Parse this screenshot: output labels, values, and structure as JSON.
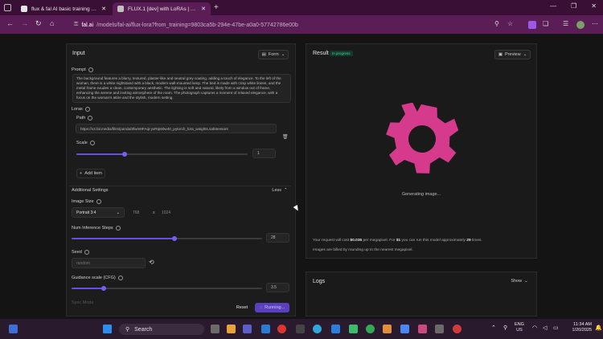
{
  "browser": {
    "tabs": [
      {
        "title": "flux & fal AI basic training Lo...",
        "active": false
      },
      {
        "title": "FLUX.1 [dev] with LoRAs | Text t...",
        "active": true
      }
    ],
    "url_host": "fal.ai",
    "url_path": "/models/fal-ai/flux-lora?from_training=9803ca5b-294e-47be-a0a0-57742786e00b"
  },
  "input_panel": {
    "title": "Input",
    "form_button": "Form",
    "prompt_label": "Prompt",
    "prompt_text": "The background features a blurry, textured, plaster-like and neutral grey coating, adding a touch of elegance. To the left of the woman, there is a white nightstand with a black, modern wall-mounted lamp. The bed is made with crisp white linens, and the metal frame exudes a clean, contemporary aesthetic. The lighting is soft and natural, likely from a window out of frame, enhancing the serene and inviting atmosphere of the room. The photograph captures a moment of relaxed elegance, with a focus on the woman's attire and the stylish, modern setting.",
    "loras_label": "Loras",
    "path_label": "Path",
    "path_value": "https://v3.fal.media/files/panda/8fwm8FAqi-yxRtp60w40_pytorch_lora_weights.safetensors",
    "scale_label": "Scale",
    "scale_value": "1",
    "scale_fraction": 0.28,
    "add_item": "Add item",
    "additional_settings": "Additional Settings",
    "less_button": "Less",
    "image_size_label": "Image Size",
    "image_size_value": "Portrait 3:4",
    "width_value": "768",
    "x_sep": "x",
    "height_value": "1024",
    "steps_label": "Num Inference Steps",
    "steps_value": "28",
    "steps_fraction": 0.54,
    "seed_label": "Seed",
    "seed_placeholder": "random",
    "guidance_label": "Guidance scale (CFG)",
    "guidance_value": "3.5",
    "guidance_fraction": 0.17,
    "sync_mode_label": "Sync Mode",
    "reset_button": "Reset",
    "run_button": "Running..."
  },
  "result_panel": {
    "title": "Result",
    "status_badge": "In progress",
    "preview_button": "Preview",
    "generating": "Generating image...",
    "cost_prefix": "Your request will cost ",
    "cost_value": "$0.035",
    "cost_mid": " per megapixel. For ",
    "cost_dollar": "$1",
    "cost_mid2": " you can run this model approximately ",
    "cost_runs": "29",
    "cost_suffix": " times.",
    "billing_note": "Images are billed by rounding up to the nearest megapixel."
  },
  "logs_panel": {
    "title": "Logs",
    "show_button": "Show"
  },
  "taskbar": {
    "search": "Search",
    "lang_top": "ENG",
    "lang_bottom": "US",
    "time": "11:34 AM",
    "date": "1/20/2025"
  },
  "colors": {
    "accent": "#6b4ce6",
    "spinner": "#d63a8c",
    "tab_bg": "#3a0f35",
    "address_bg": "#5b1d55"
  }
}
